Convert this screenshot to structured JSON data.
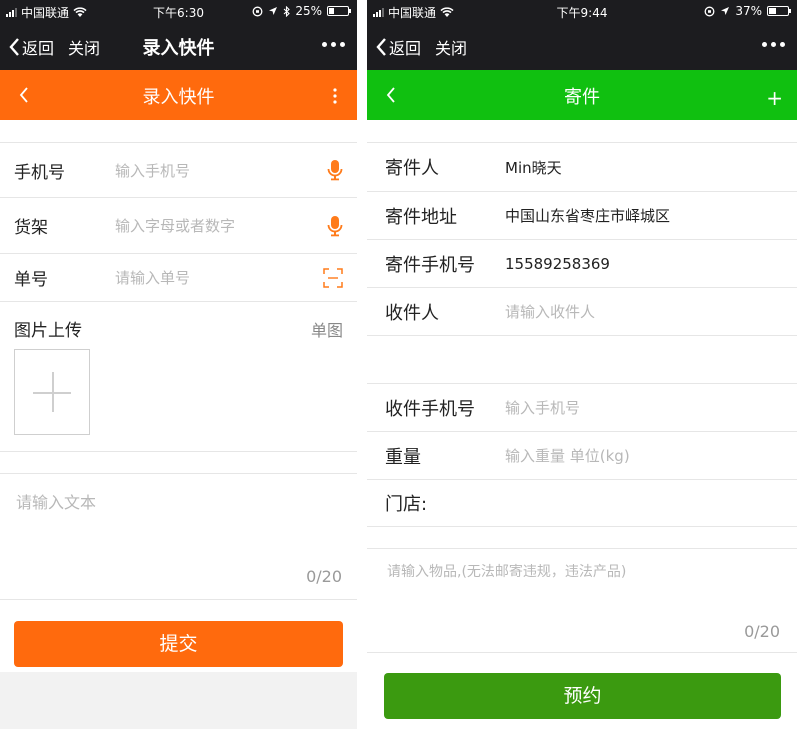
{
  "left": {
    "status": {
      "carrier": "中国联通",
      "time": "下午6:30",
      "battery": "25%",
      "battery_fraction": 0.25
    },
    "nav": {
      "back_label": "返回",
      "close_label": "关闭",
      "title": "录入快件"
    },
    "page": {
      "title": "录入快件"
    },
    "form": {
      "phone": {
        "label": "手机号",
        "placeholder": "输入手机号"
      },
      "shelf": {
        "label": "货架",
        "placeholder": "输入字母或者数字"
      },
      "number": {
        "label": "单号",
        "placeholder": "请输入单号"
      },
      "upload": {
        "label": "图片上传",
        "mode": "单图"
      },
      "text": {
        "placeholder": "请输入文本",
        "counter": "0/20"
      }
    },
    "submit_label": "提交",
    "colors": {
      "accent": "#ff6a0d",
      "button": "#ff6a0d"
    }
  },
  "right": {
    "status": {
      "carrier": "中国联通",
      "time": "下午9:44",
      "battery": "37%",
      "battery_fraction": 0.37
    },
    "nav": {
      "back_label": "返回",
      "close_label": "关闭"
    },
    "page": {
      "title": "寄件",
      "action": "+"
    },
    "form": {
      "sender": {
        "label": "寄件人",
        "value": "Min晓天"
      },
      "sender_address": {
        "label": "寄件地址",
        "value": "中国山东省枣庄市峄城区"
      },
      "sender_phone": {
        "label": "寄件手机号",
        "value": "15589258369"
      },
      "receiver": {
        "label": "收件人",
        "placeholder": "请输入收件人"
      },
      "receiver_phone": {
        "label": "收件手机号",
        "placeholder": "输入手机号"
      },
      "weight": {
        "label": "重量",
        "placeholder": "输入重量 单位(kg)"
      },
      "store": {
        "label": "门店:"
      },
      "goods": {
        "placeholder": "请输入物品,(无法邮寄违规，违法产品)",
        "counter": "0/20"
      }
    },
    "submit_label": "预约",
    "colors": {
      "accent": "#10c010",
      "button": "#3b9a10"
    }
  }
}
